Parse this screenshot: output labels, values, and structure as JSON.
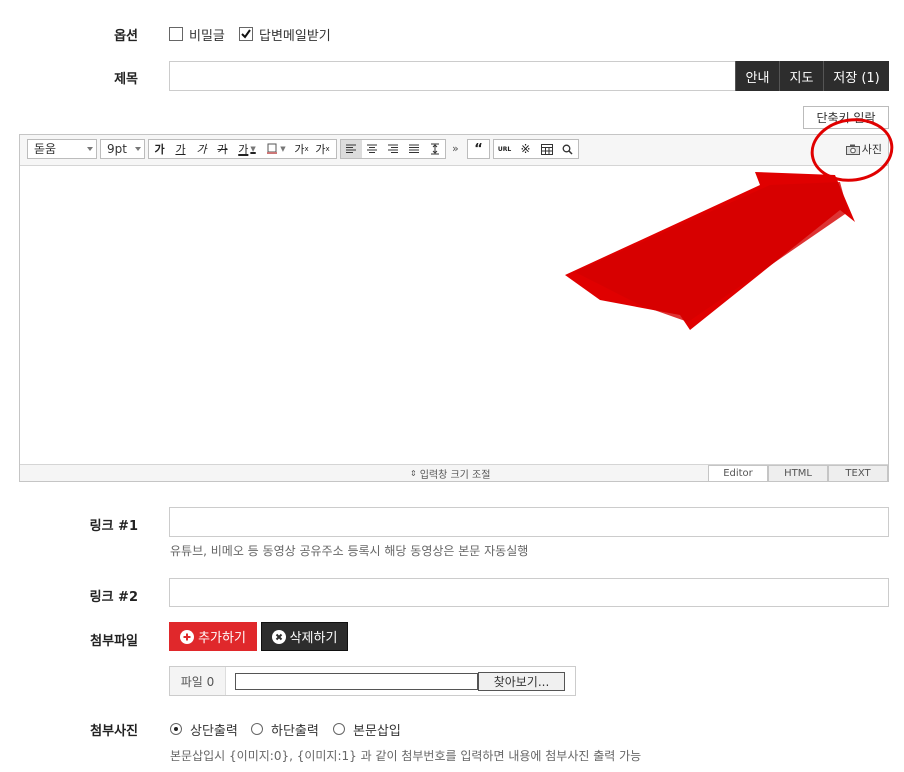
{
  "options": {
    "label": "옵션",
    "secret_label": "비밀글",
    "secret_checked": false,
    "reply_mail_label": "답변메일받기",
    "reply_mail_checked": true
  },
  "subject": {
    "label": "제목",
    "value": "",
    "guide_button": "안내",
    "map_button": "지도",
    "save_button": "저장 (1)"
  },
  "shortcut_button": "단축키 일람",
  "editor": {
    "font_select": "돋움",
    "size_select": "9pt",
    "format_buttons": [
      "가",
      "가",
      "가",
      "가",
      "가",
      "가",
      "가",
      "가",
      "가"
    ],
    "url_button": "URL",
    "photo_button": "사진",
    "resize_label": "입력창 크기 조절",
    "modes": [
      "Editor",
      "HTML",
      "TEXT"
    ],
    "active_mode": "Editor",
    "content": ""
  },
  "link1": {
    "label": "링크 #1",
    "value": "",
    "help": "유튜브, 비메오 등 동영상 공유주소 등록시 해당 동영상은 본문 자동실행"
  },
  "link2": {
    "label": "링크 #2",
    "value": ""
  },
  "attach_file": {
    "label": "첨부파일",
    "add_button": "추가하기",
    "delete_button": "삭제하기",
    "file_label": "파일 0",
    "browse_button": "찾아보기..."
  },
  "attach_photo": {
    "label": "첨부사진",
    "options": [
      "상단출력",
      "하단출력",
      "본문삽입"
    ],
    "selected": "상단출력",
    "help": "본문삽입시 {이미지:0}, {이미지:1} 과 같이 첨부번호를 입력하면 내용에 첨부사진 출력 가능"
  },
  "colors": {
    "dark_button": "#2d2d2d",
    "add_button": "#e0282b",
    "annotation": "#e00000"
  }
}
